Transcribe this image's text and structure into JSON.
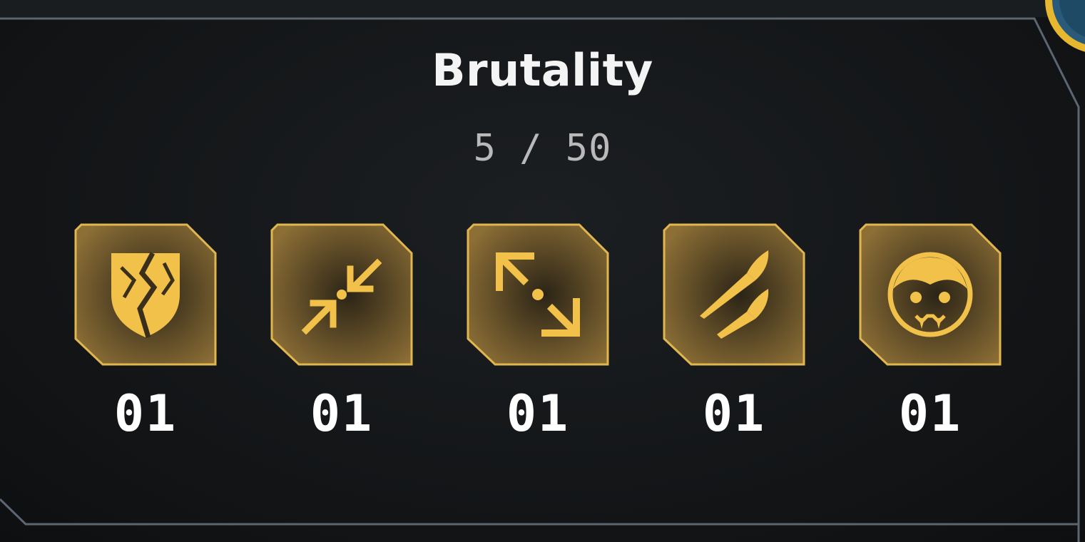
{
  "panel": {
    "title": "Brutality",
    "progress": "5 / 50"
  },
  "colors": {
    "accent": "#f2c14a",
    "tile_border": "#e0b64e",
    "tile_fill_top": "#8a6d35",
    "tile_fill_bottom": "#2e2516",
    "title_text": "#f4f4f4",
    "progress_text": "#b9b9b9",
    "count_text": "#ffffff"
  },
  "perks": [
    {
      "icon": "cracked-shield-icon",
      "count": "01"
    },
    {
      "icon": "converging-arrows-icon",
      "count": "01"
    },
    {
      "icon": "diverging-arrows-icon",
      "count": "01"
    },
    {
      "icon": "twin-rockets-icon",
      "count": "01"
    },
    {
      "icon": "vampire-face-icon",
      "count": "01"
    }
  ]
}
